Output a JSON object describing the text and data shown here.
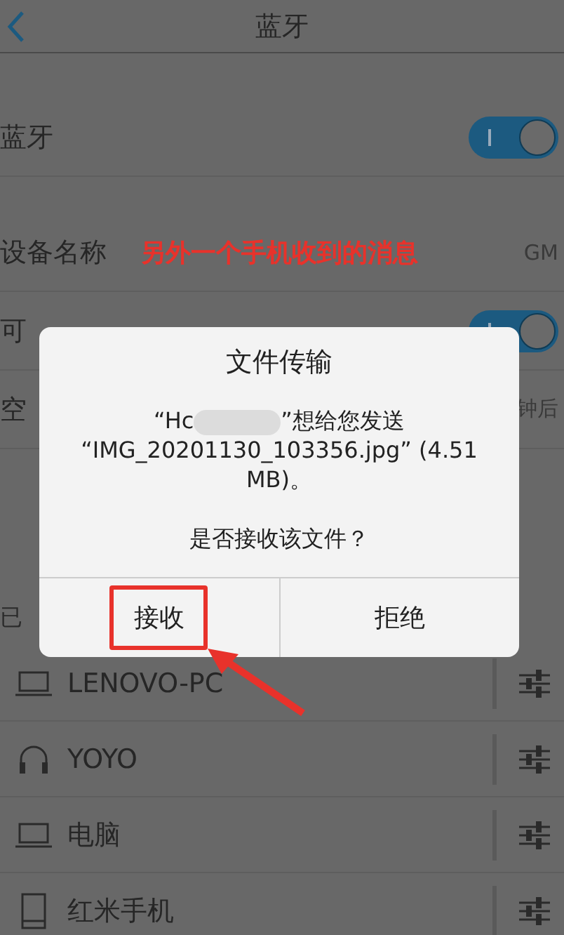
{
  "header": {
    "title": "蓝牙"
  },
  "settings": [
    {
      "label": "蓝牙",
      "kind": "toggle",
      "on": true
    },
    {
      "label": "设备名称",
      "kind": "value",
      "value": "GM"
    },
    {
      "label": "可",
      "kind": "toggle",
      "on": true
    },
    {
      "label": "空",
      "kind": "value",
      "value": "钟后"
    }
  ],
  "annotation": "另外一个手机收到的消息",
  "paired_header": "已",
  "devices": [
    {
      "name": "LENOVO-PC",
      "kind": "laptop"
    },
    {
      "name": "YOYO",
      "kind": "headphones"
    },
    {
      "name": "电脑",
      "kind": "laptop"
    },
    {
      "name": "红米手机",
      "kind": "phone"
    }
  ],
  "dialog": {
    "title": "文件传输",
    "sender": "“Hc",
    "message_rest": "”想给您发送 “IMG_20201130_103356.jpg” (4.51 MB)。",
    "question": "是否接收该文件？",
    "buttons": [
      {
        "label": "接收",
        "highlighted": true
      },
      {
        "label": "拒绝",
        "highlighted": false
      }
    ]
  }
}
